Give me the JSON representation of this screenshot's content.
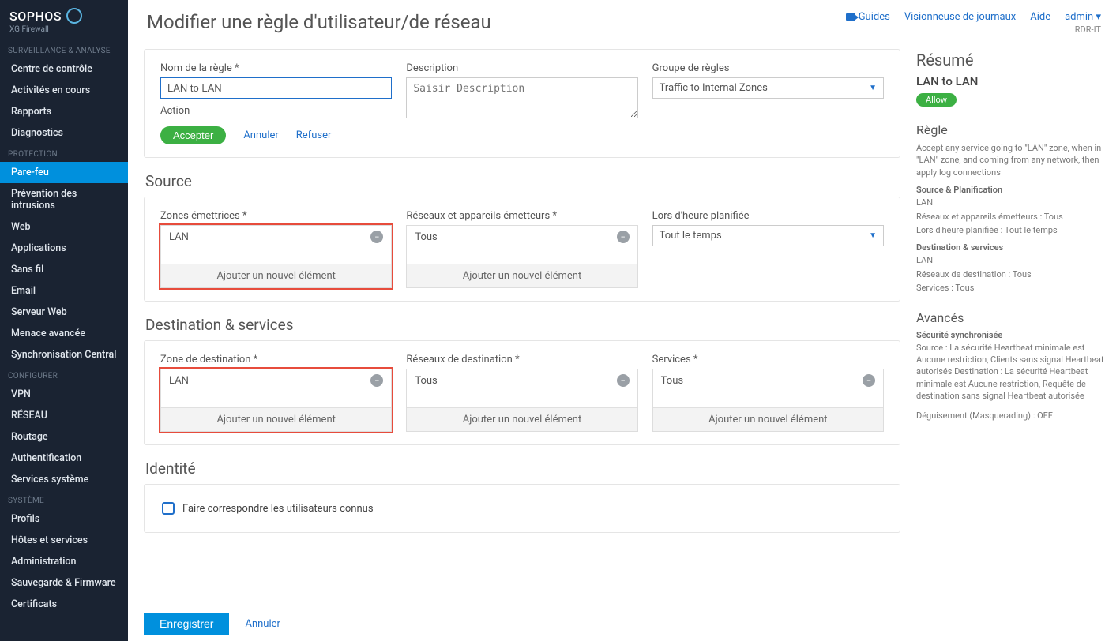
{
  "brand": {
    "name": "SOPHOS",
    "product": "XG Firewall"
  },
  "sidebar": {
    "sections": [
      {
        "header": "SURVEILLANCE & ANALYSE",
        "items": [
          "Centre de contrôle",
          "Activités en cours",
          "Rapports",
          "Diagnostics"
        ]
      },
      {
        "header": "PROTECTION",
        "items": [
          "Pare-feu",
          "Prévention des intrusions",
          "Web",
          "Applications",
          "Sans fil",
          "Email",
          "Serveur Web",
          "Menace avancée",
          "Synchronisation Central"
        ],
        "activeIndex": 0
      },
      {
        "header": "CONFIGURER",
        "items": [
          "VPN",
          "RÉSEAU",
          "Routage",
          "Authentification",
          "Services système"
        ]
      },
      {
        "header": "SYSTÈME",
        "items": [
          "Profils",
          "Hôtes et services",
          "Administration",
          "Sauvegarde & Firmware",
          "Certificats"
        ]
      }
    ]
  },
  "header": {
    "title": "Modifier une règle d'utilisateur/de réseau",
    "links": {
      "guides": "Guides",
      "logs": "Visionneuse de journaux",
      "help": "Aide",
      "admin": "admin",
      "tenant": "RDR-IT"
    }
  },
  "form": {
    "ruleName": {
      "label": "Nom de la règle *",
      "value": "LAN to LAN"
    },
    "description": {
      "label": "Description",
      "placeholder": "Saisir Description"
    },
    "ruleGroup": {
      "label": "Groupe de règles",
      "value": "Traffic to Internal Zones"
    },
    "actionLabel": "Action",
    "actions": {
      "accept": "Accepter",
      "cancel": "Annuler",
      "refuse": "Refuser"
    }
  },
  "sourceSection": {
    "title": "Source",
    "zones": {
      "label": "Zones émettrices *",
      "items": [
        "LAN"
      ],
      "addLabel": "Ajouter un nouvel élément"
    },
    "networks": {
      "label": "Réseaux et appareils émetteurs *",
      "items": [
        "Tous"
      ],
      "addLabel": "Ajouter un nouvel élément"
    },
    "schedule": {
      "label": "Lors d'heure planifiée",
      "value": "Tout le temps"
    }
  },
  "destSection": {
    "title": "Destination & services",
    "zone": {
      "label": "Zone de destination *",
      "items": [
        "LAN"
      ],
      "addLabel": "Ajouter un nouvel élément"
    },
    "networks": {
      "label": "Réseaux de destination *",
      "items": [
        "Tous"
      ],
      "addLabel": "Ajouter un nouvel élément"
    },
    "services": {
      "label": "Services *",
      "items": [
        "Tous"
      ],
      "addLabel": "Ajouter un nouvel élément"
    }
  },
  "identity": {
    "title": "Identité",
    "checkboxLabel": "Faire correspondre les utilisateurs connus"
  },
  "summary": {
    "title": "Résumé",
    "ruleName": "LAN to LAN",
    "badge": "Allow",
    "ruleHeader": "Règle",
    "ruleText": "Accept any service going to \"LAN\" zone, when in \"LAN\" zone, and coming from any network, then apply log connections",
    "srcHeader": "Source & Planification",
    "srcLines": [
      "LAN",
      "Réseaux et appareils émetteurs : Tous",
      "Lors d'heure planifiée : Tout le temps"
    ],
    "dstHeader": "Destination & services",
    "dstLines": [
      "LAN",
      "Réseaux de destination : Tous",
      "Services : Tous"
    ],
    "advHeader": "Avancés",
    "advSub": "Sécurité synchronisée",
    "advText": "Source : La sécurité Heartbeat minimale est Aucune restriction, Clients sans signal Heartbeat autorisés Destination : La sécurité Heartbeat minimale est Aucune restriction, Requête de destination sans signal Heartbeat autorisée",
    "masq": "Déguisement (Masquerading) : OFF"
  },
  "footer": {
    "save": "Enregistrer",
    "cancel": "Annuler"
  }
}
